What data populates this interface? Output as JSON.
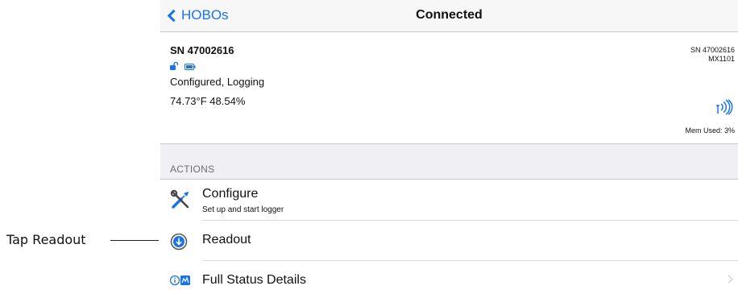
{
  "callout": {
    "label": "Tap Readout"
  },
  "navbar": {
    "back_label": "HOBOs",
    "title": "Connected"
  },
  "device": {
    "serial_label": "SN 47002616",
    "status": "Configured, Logging",
    "readings": "74.73°F  48.54%",
    "right_serial": "SN 47002616",
    "model": "MX1101",
    "mem_used": "Mem Used: 3%",
    "icons": [
      "unlock-icon",
      "battery-icon",
      "signal-icon"
    ]
  },
  "actions": {
    "header": "ACTIONS",
    "configure": {
      "title": "Configure",
      "subtitle": "Set up and start logger"
    },
    "readout": {
      "title": "Readout"
    },
    "full_status": {
      "title": "Full Status Details"
    }
  },
  "colors": {
    "accent": "#1a73e8",
    "group_bg": "#efeff4",
    "separator": "#c8c7cc"
  }
}
